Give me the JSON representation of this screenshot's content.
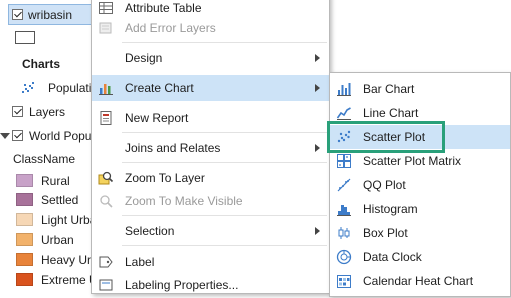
{
  "contents_pane": {
    "layer_name": "wribasin",
    "charts_heading": "Charts",
    "chart_item": "Population",
    "layers_group": "Layers",
    "world_layer": "World Population",
    "field_name": "ClassName",
    "classes": [
      {
        "label": "Rural",
        "color": "#c8a2c8"
      },
      {
        "label": "Settled",
        "color": "#a8729a"
      },
      {
        "label": "Light Urban",
        "color": "#f6d7b5"
      },
      {
        "label": "Urban",
        "color": "#f2b26b"
      },
      {
        "label": "Heavy Urban",
        "color": "#e8833a"
      },
      {
        "label": "Extreme Urban",
        "color": "#d9531e"
      }
    ]
  },
  "context_menu": {
    "attribute_table": "Attribute Table",
    "add_error_layers": "Add Error Layers",
    "design": "Design",
    "create_chart": "Create Chart",
    "new_report": "New Report",
    "joins_relates": "Joins and Relates",
    "zoom_to_layer": "Zoom To Layer",
    "zoom_visible": "Zoom To Make Visible",
    "selection": "Selection",
    "label": "Label",
    "labeling_properties": "Labeling Properties..."
  },
  "chart_submenu": {
    "items": [
      {
        "label": "Bar Chart",
        "icon": "bar-chart-icon"
      },
      {
        "label": "Line Chart",
        "icon": "line-chart-icon"
      },
      {
        "label": "Scatter Plot",
        "icon": "scatter-plot-icon"
      },
      {
        "label": "Scatter Plot Matrix",
        "icon": "scatter-matrix-icon"
      },
      {
        "label": "QQ Plot",
        "icon": "qq-plot-icon"
      },
      {
        "label": "Histogram",
        "icon": "histogram-icon"
      },
      {
        "label": "Box Plot",
        "icon": "box-plot-icon"
      },
      {
        "label": "Data Clock",
        "icon": "data-clock-icon"
      },
      {
        "label": "Calendar Heat Chart",
        "icon": "calendar-heat-icon"
      }
    ],
    "highlighted": "Scatter Plot"
  },
  "colors": {
    "highlight": "#cde3f7",
    "focus_outline": "#29a07a",
    "icon_blue": "#3d7cc9"
  }
}
